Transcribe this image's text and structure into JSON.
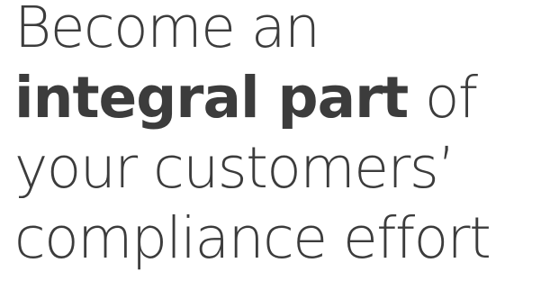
{
  "headline": {
    "line1": "Become an",
    "line2_bold": "integral part",
    "line2_rest": " of",
    "line3": "your customers’",
    "line4": "compliance effort"
  },
  "colors": {
    "text": "#3c3c3c",
    "background": "#ffffff"
  }
}
